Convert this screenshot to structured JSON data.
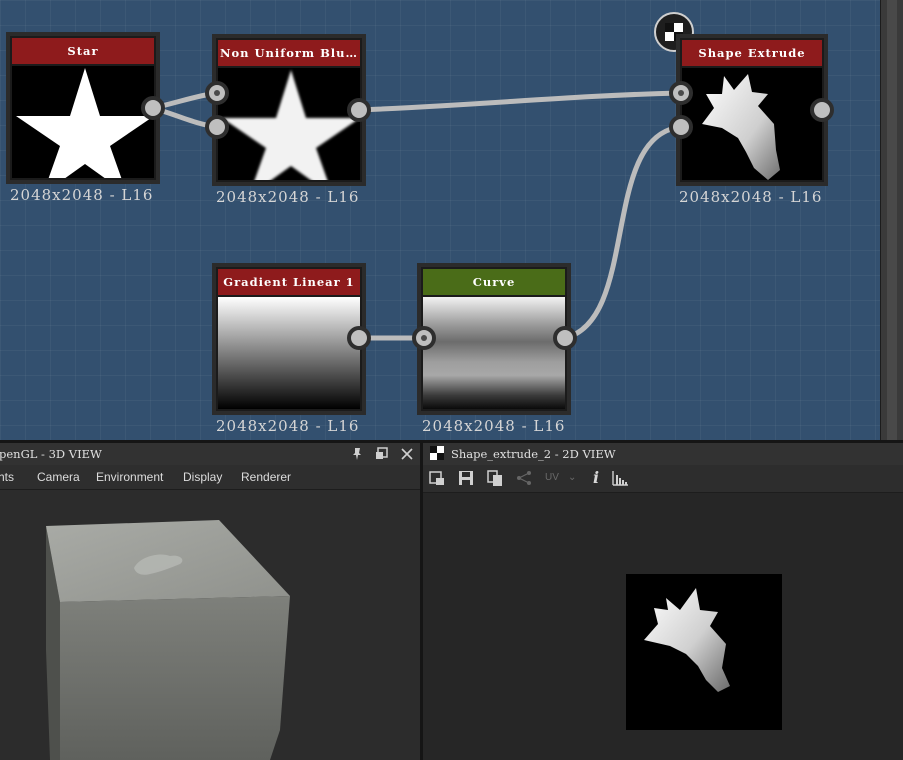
{
  "graph": {
    "nodes": [
      {
        "id": "star",
        "title": "Star",
        "resolution": "2048x2048 - L16",
        "header_color": "#8e1b1c"
      },
      {
        "id": "blur",
        "title": "Non Uniform Blu…",
        "resolution": "2048x2048 - L16",
        "header_color": "#8e1b1c"
      },
      {
        "id": "extrude",
        "title": "Shape Extrude",
        "resolution": "2048x2048 - L16",
        "header_color": "#8e1b1c"
      },
      {
        "id": "gradient",
        "title": "Gradient Linear 1",
        "resolution": "2048x2048 - L16",
        "header_color": "#8e1b1c"
      },
      {
        "id": "curve",
        "title": "Curve",
        "resolution": "2048x2048 - L16",
        "header_color": "#4a6c18"
      }
    ],
    "output_icon": "checker-output-icon"
  },
  "panel3d": {
    "title": "penGL - 3D VIEW",
    "menu": [
      "hts",
      "Camera",
      "Environment",
      "Display",
      "Renderer"
    ],
    "header_icons": [
      "pin-icon",
      "float-window-icon",
      "close-icon"
    ]
  },
  "panel2d": {
    "title": "Shape_extrude_2 - 2D VIEW",
    "toolbar": {
      "icons": [
        "export-view-icon",
        "save-icon",
        "copy-icon",
        "share-icon",
        "info-icon",
        "histogram-icon"
      ],
      "uv_label": "UV",
      "info_label": "i"
    }
  }
}
